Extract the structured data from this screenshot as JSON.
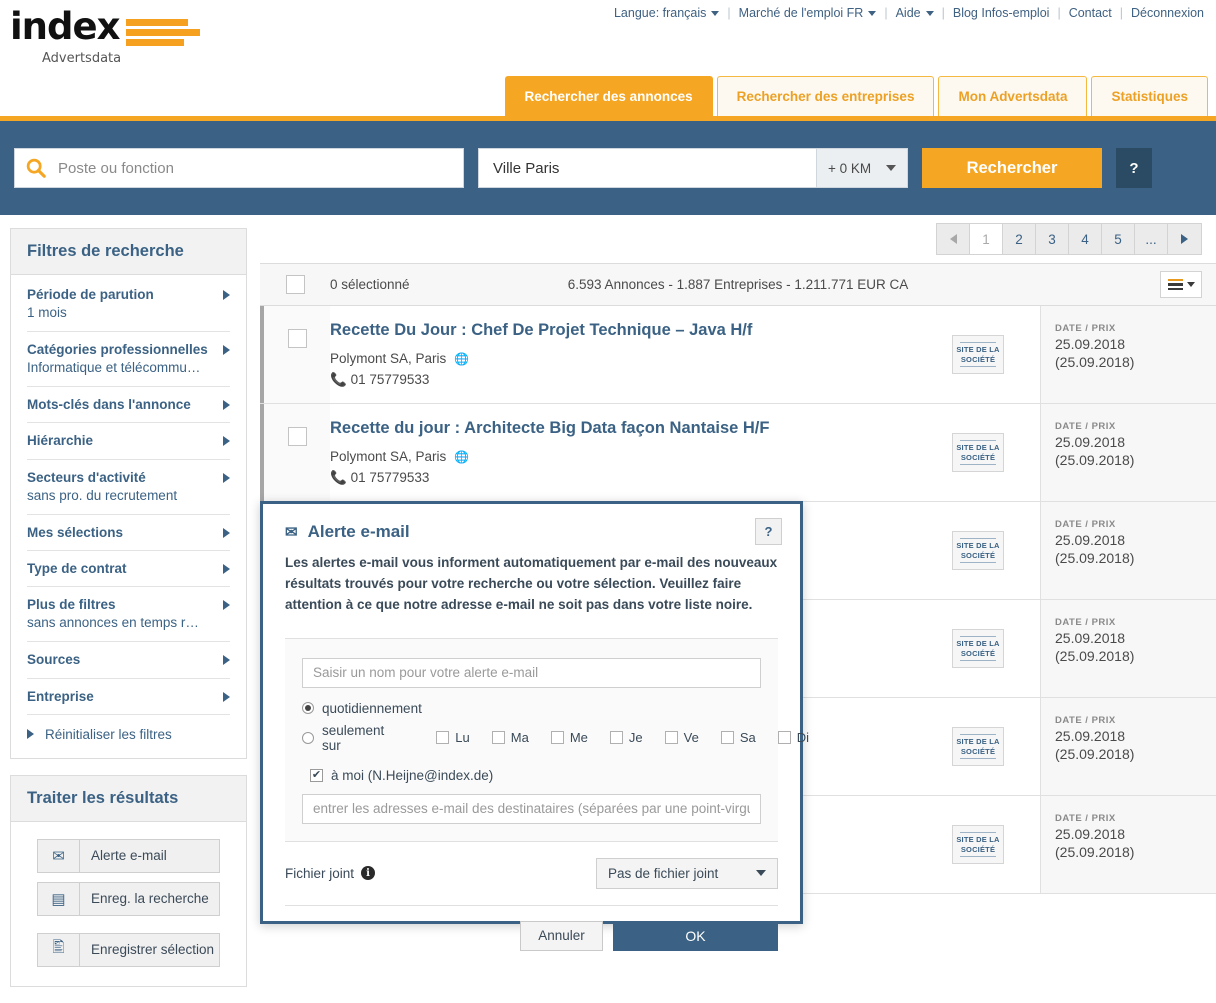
{
  "brand": {
    "name": "index",
    "subtitle": "Advertsdata",
    "accent": "#f5a623",
    "header_blue": "#3b6284"
  },
  "topbar": {
    "language": "Langue: français",
    "market": "Marché de l'emploi FR",
    "help": "Aide",
    "blog": "Blog Infos-emploi",
    "contact": "Contact",
    "logout": "Déconnexion"
  },
  "tabs": [
    {
      "label": "Rechercher des annonces",
      "active": true
    },
    {
      "label": "Rechercher des entreprises",
      "active": false
    },
    {
      "label": "Mon Advertsdata",
      "active": false
    },
    {
      "label": "Statistiques",
      "active": false
    }
  ],
  "search": {
    "job_placeholder": "Poste ou fonction",
    "job_value": "",
    "city_value": "Ville Paris",
    "radius": "+ 0 KM",
    "button": "Rechercher",
    "help": "?"
  },
  "filters": {
    "title": "Filtres de recherche",
    "items": [
      {
        "title": "Période de parution",
        "sub": "1 mois"
      },
      {
        "title": "Catégories professionnelles",
        "sub": "Informatique et télécommunic..."
      },
      {
        "title": "Mots-clés dans l'annonce",
        "sub": ""
      },
      {
        "title": "Hiérarchie",
        "sub": ""
      },
      {
        "title": "Secteurs d'activité",
        "sub": "sans pro. du recrutement"
      },
      {
        "title": "Mes sélections",
        "sub": ""
      },
      {
        "title": "Type de contrat",
        "sub": ""
      },
      {
        "title": "Plus de filtres",
        "sub": "sans annonces en temps réel"
      },
      {
        "title": "Sources",
        "sub": ""
      },
      {
        "title": "Entreprise",
        "sub": ""
      }
    ],
    "reset": "Réinitialiser les filtres"
  },
  "actions": {
    "title": "Traiter les résultats",
    "items": [
      {
        "label": "Alerte e-mail",
        "icon": "envelope-icon"
      },
      {
        "label": "Enreg. la recherche",
        "icon": "floppy-disk-icon"
      },
      {
        "label": "Enregistrer sélection",
        "icon": "document-save-icon"
      }
    ]
  },
  "pagination": {
    "prev": "◀",
    "pages": [
      "1",
      "2",
      "3",
      "4",
      "5",
      "..."
    ],
    "current": "1",
    "next": "▶"
  },
  "summary": {
    "selected": "0 sélectionné",
    "counts": "6.593 Annonces  -  1.887 Entreprises  -  1.211.771 EUR CA"
  },
  "results": [
    {
      "title": "Recette Du Jour : Chef De Projet Technique – Java H/f",
      "company": "Polymont SA, Paris",
      "phone": "01 75779533",
      "badge": "SITE DE LA SOCIÉTÉ",
      "date_label": "DATE / PRIX",
      "date": "25.09.2018",
      "date2": "(25.09.2018)"
    },
    {
      "title": "Recette du jour : Architecte Big Data façon Nantaise H/F",
      "company": "Polymont SA, Paris",
      "phone": "01 75779533",
      "badge": "SITE DE LA SOCIÉTÉ",
      "date_label": "DATE / PRIX",
      "date": "25.09.2018",
      "date2": "(25.09.2018)"
    },
    {
      "title": "",
      "company": "",
      "phone": "",
      "badge": "SITE DE LA SOCIÉTÉ",
      "date_label": "DATE / PRIX",
      "date": "25.09.2018",
      "date2": "(25.09.2018)"
    },
    {
      "title": "",
      "company": "",
      "phone": "",
      "badge": "SITE DE LA SOCIÉTÉ",
      "date_label": "DATE / PRIX",
      "date": "25.09.2018",
      "date2": "(25.09.2018)"
    },
    {
      "title": "",
      "company": "",
      "phone": "",
      "badge": "SITE DE LA SOCIÉTÉ",
      "date_label": "DATE / PRIX",
      "date": "25.09.2018",
      "date2": "(25.09.2018)"
    },
    {
      "title": "",
      "company": "",
      "phone": "",
      "badge": "SITE DE LA SOCIÉTÉ",
      "date_label": "DATE / PRIX",
      "date": "25.09.2018",
      "date2": "(25.09.2018)"
    }
  ],
  "modal": {
    "title": "Alerte e-mail",
    "help": "?",
    "description": "Les alertes e-mail vous informent automatiquement par e-mail des nouveaux résultats trouvés pour votre recherche ou votre sélection. Veuillez faire attention à ce que notre adresse e-mail ne soit pas dans votre liste noire.",
    "name_placeholder": "Saisir un nom pour votre alerte e-mail",
    "name_value": "",
    "freq_daily": "quotidiennement",
    "freq_only": "seulement sur",
    "freq_selected": "quotidiennement",
    "days": [
      {
        "label": "Lu",
        "checked": false
      },
      {
        "label": "Ma",
        "checked": false
      },
      {
        "label": "Me",
        "checked": false
      },
      {
        "label": "Je",
        "checked": false
      },
      {
        "label": "Ve",
        "checked": false
      },
      {
        "label": "Sa",
        "checked": false
      },
      {
        "label": "Di",
        "checked": false
      }
    ],
    "to_me": "à moi (N.Heijne@index.de)",
    "to_me_checked": true,
    "recipients_placeholder": "entrer les adresses e-mail des destinataires (séparées par une point-virgu",
    "recipients_value": "",
    "attachment_label": "Fichier joint",
    "attachment_value": "Pas de fichier joint",
    "cancel": "Annuler",
    "ok": "OK"
  }
}
